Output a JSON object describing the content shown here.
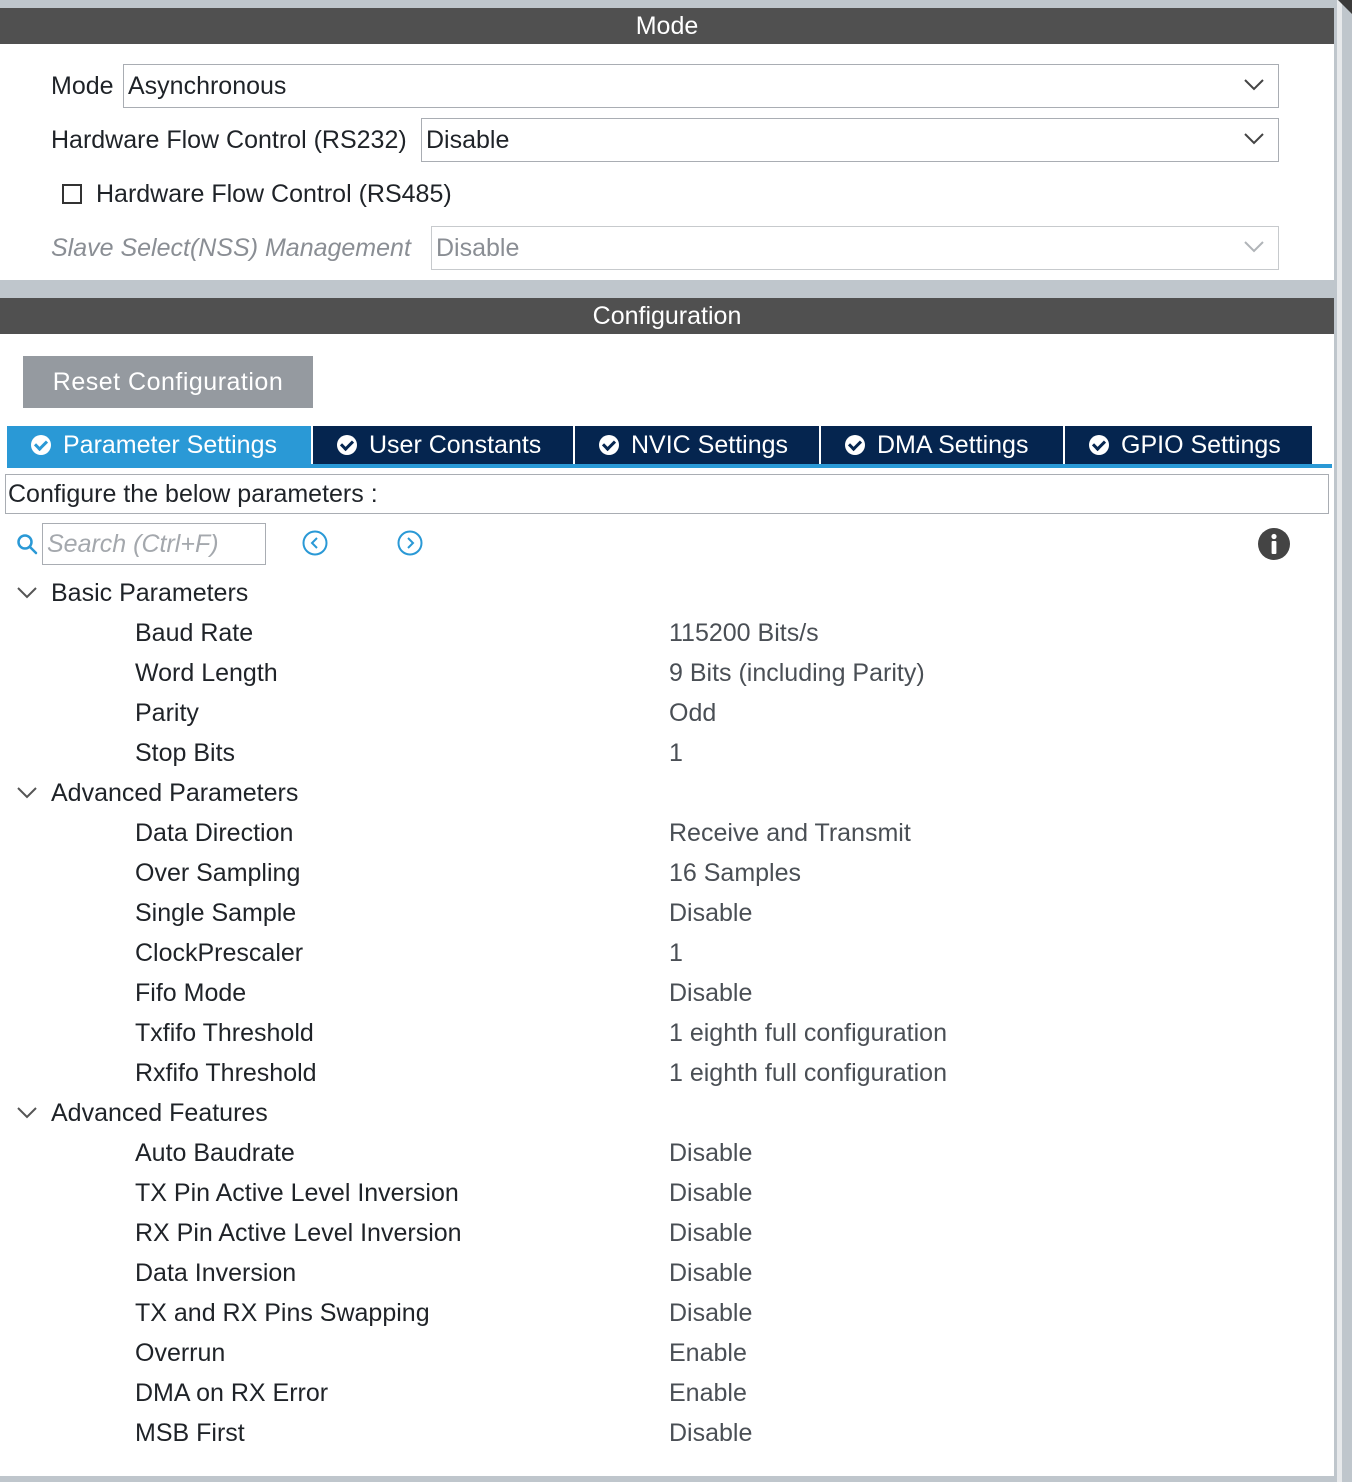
{
  "mode_section": {
    "header": "Mode",
    "mode_label": "Mode",
    "mode_value": "Asynchronous",
    "hw_flow_label": "Hardware Flow Control (RS232)",
    "hw_flow_value": "Disable",
    "rs485_label": "Hardware Flow Control (RS485)",
    "rs485_checked": false,
    "nss_label": "Slave Select(NSS) Management",
    "nss_value": "Disable"
  },
  "config_section": {
    "header": "Configuration",
    "reset_label": "Reset Configuration",
    "tabs": [
      {
        "label": "Parameter Settings",
        "active": true
      },
      {
        "label": "User Constants",
        "active": false
      },
      {
        "label": "NVIC Settings",
        "active": false
      },
      {
        "label": "DMA Settings",
        "active": false
      },
      {
        "label": "GPIO Settings",
        "active": false
      }
    ],
    "description": "Configure the below parameters :",
    "search_placeholder": "Search (Ctrl+F)"
  },
  "groups": [
    {
      "name": "Basic Parameters",
      "params": [
        {
          "name": "Baud Rate",
          "value": "115200 Bits/s"
        },
        {
          "name": "Word Length",
          "value": "9 Bits (including Parity)"
        },
        {
          "name": "Parity",
          "value": "Odd"
        },
        {
          "name": "Stop Bits",
          "value": "1"
        }
      ]
    },
    {
      "name": "Advanced Parameters",
      "params": [
        {
          "name": "Data Direction",
          "value": "Receive and Transmit"
        },
        {
          "name": "Over Sampling",
          "value": "16 Samples"
        },
        {
          "name": "Single Sample",
          "value": "Disable"
        },
        {
          "name": "ClockPrescaler",
          "value": "1"
        },
        {
          "name": "Fifo Mode",
          "value": "Disable"
        },
        {
          "name": "Txfifo Threshold",
          "value": "1 eighth full configuration"
        },
        {
          "name": "Rxfifo Threshold",
          "value": "1 eighth full configuration"
        }
      ]
    },
    {
      "name": "Advanced Features",
      "params": [
        {
          "name": "Auto Baudrate",
          "value": "Disable"
        },
        {
          "name": "TX Pin Active Level Inversion",
          "value": "Disable"
        },
        {
          "name": "RX Pin Active Level Inversion",
          "value": "Disable"
        },
        {
          "name": "Data Inversion",
          "value": "Disable"
        },
        {
          "name": "TX and RX Pins Swapping",
          "value": "Disable"
        },
        {
          "name": "Overrun",
          "value": "Enable"
        },
        {
          "name": "DMA on RX Error",
          "value": "Enable"
        },
        {
          "name": "MSB First",
          "value": "Disable"
        }
      ]
    }
  ],
  "colors": {
    "header_bg": "#505050",
    "tab_active": "#2a99d6",
    "tab_inactive": "#05254f",
    "reset_button": "#959aa0"
  }
}
